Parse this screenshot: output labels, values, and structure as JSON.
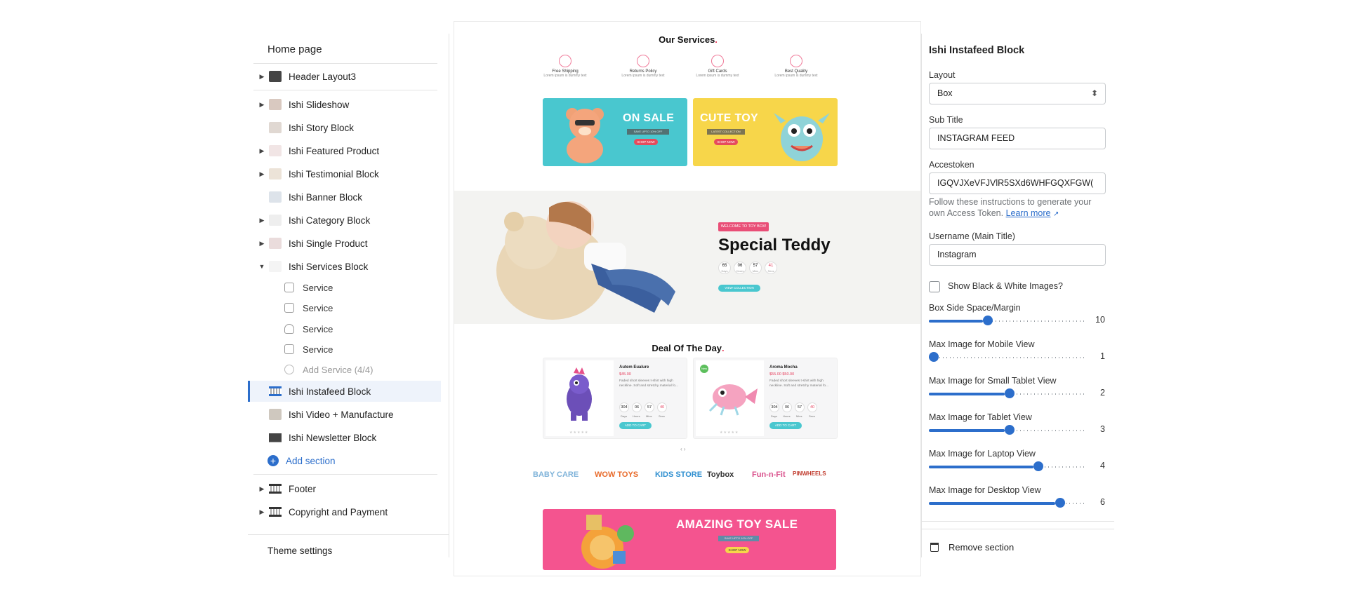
{
  "sidebar": {
    "title": "Home page",
    "items": [
      {
        "label": "Header Layout3",
        "caret": "▶"
      },
      {
        "label": "Ishi Slideshow",
        "caret": "▶"
      },
      {
        "label": "Ishi Story Block",
        "caret": ""
      },
      {
        "label": "Ishi Featured Product",
        "caret": "▶"
      },
      {
        "label": "Ishi Testimonial Block",
        "caret": "▶"
      },
      {
        "label": "Ishi Banner Block",
        "caret": ""
      },
      {
        "label": "Ishi Category Block",
        "caret": "▶"
      },
      {
        "label": "Ishi Single Product",
        "caret": "▶"
      },
      {
        "label": "Ishi Services Block",
        "caret": "▼"
      }
    ],
    "services": [
      {
        "label": "Service"
      },
      {
        "label": "Service"
      },
      {
        "label": "Service"
      },
      {
        "label": "Service"
      }
    ],
    "add_service": "Add Service (4/4)",
    "active_item": "Ishi Instafeed Block",
    "more_items": [
      {
        "label": "Ishi Video + Manufacture"
      },
      {
        "label": "Ishi Newsletter Block"
      }
    ],
    "add_section": "Add section",
    "footer_items": [
      {
        "label": "Footer",
        "caret": "▶"
      },
      {
        "label": "Copyright and Payment",
        "caret": "▶"
      }
    ],
    "theme_settings": "Theme settings"
  },
  "preview": {
    "services_title": "Our Services",
    "services": [
      {
        "name": "Free Shipping",
        "desc": "Lorem ipsum is dummy text"
      },
      {
        "name": "Returns Policy",
        "desc": "Lorem ipsum is dummy text"
      },
      {
        "name": "Gift Cards",
        "desc": "Lorem ipsum is dummy text"
      },
      {
        "name": "Best Quality",
        "desc": "Lorem ipsum is dummy text"
      }
    ],
    "banner1": {
      "title": "ON SALE",
      "tag": "SAVE UPTO 10% OFF",
      "button": "SHOP NOW"
    },
    "banner2": {
      "title": "CUTE TOY",
      "tag": "LATEST COLLECTION",
      "button": "SHOP NOW"
    },
    "hero": {
      "badge": "WELCOME TO TOY BOX!",
      "title": "Special Teddy",
      "countdown": [
        {
          "v": "65",
          "l": "Days"
        },
        {
          "v": "06",
          "l": "Hours"
        },
        {
          "v": "57",
          "l": "Mins"
        },
        {
          "v": "41",
          "l": "Secs"
        }
      ],
      "button": "VIEW COLLECTION"
    },
    "deal_title": "Deal Of The Day",
    "deals": [
      {
        "name": "Autem Eualure",
        "price": "$45.00",
        "desc": "Faded short sleeves t-shirt with high neckline. Soft and stretchy material fo...",
        "countdown": [
          "304",
          "06",
          "57",
          "40"
        ],
        "labels": [
          "Days",
          "Hours",
          "Mins",
          "Secs"
        ],
        "button": "ADD TO CART",
        "badge": ""
      },
      {
        "name": "Aroma Mocha",
        "price": "$55.00 $50.00",
        "desc": "Faded short sleeves t-shirt with high neckline. Soft and stretchy material fo...",
        "countdown": [
          "304",
          "06",
          "57",
          "40"
        ],
        "labels": [
          "Days",
          "Hours",
          "Mins",
          "Secs"
        ],
        "button": "ADD TO CART",
        "badge": "New"
      }
    ],
    "pager": "‹ ›",
    "brands": [
      "BABY CARE",
      "WOW TOYS",
      "KIDS STORE",
      "Toybox",
      "Fun-n-Fit",
      "PINWHEELS"
    ],
    "big_sale": {
      "title": "AMAZING TOY SALE",
      "tag": "SAVE UPTO 10% OFF",
      "button": "SHOP NOW"
    }
  },
  "settings": {
    "title": "Ishi Instafeed Block",
    "layout_label": "Layout",
    "layout_value": "Box",
    "subtitle_label": "Sub Title",
    "subtitle_value": "INSTAGRAM FEED",
    "token_label": "Accestoken",
    "token_value": "IGQVJXeVFJVlR5SXd6WHFGQXFGW(",
    "help_text": "Follow these instructions to generate your own Access Token.",
    "help_link": "Learn more",
    "username_label": "Username (Main Title)",
    "username_value": "Instagram",
    "bw_label": "Show Black & White Images?",
    "sliders": [
      {
        "label": "Box Side Space/Margin",
        "value": "10",
        "fraction": 0.34
      },
      {
        "label": "Max Image for Mobile View",
        "value": "1",
        "fraction": 0.0
      },
      {
        "label": "Max Image for Small Tablet View",
        "value": "2",
        "fraction": 0.48
      },
      {
        "label": "Max Image for Tablet View",
        "value": "3",
        "fraction": 0.48
      },
      {
        "label": "Max Image for Laptop View",
        "value": "4",
        "fraction": 0.66
      },
      {
        "label": "Max Image for Desktop View",
        "value": "6",
        "fraction": 0.8
      }
    ],
    "remove_label": "Remove section"
  },
  "colors": {
    "accent": "#2c6ecb",
    "pink": "#e63e5c",
    "teal": "#49c7cf",
    "yellow": "#f7d64a",
    "sale_pink": "#f4548f"
  }
}
